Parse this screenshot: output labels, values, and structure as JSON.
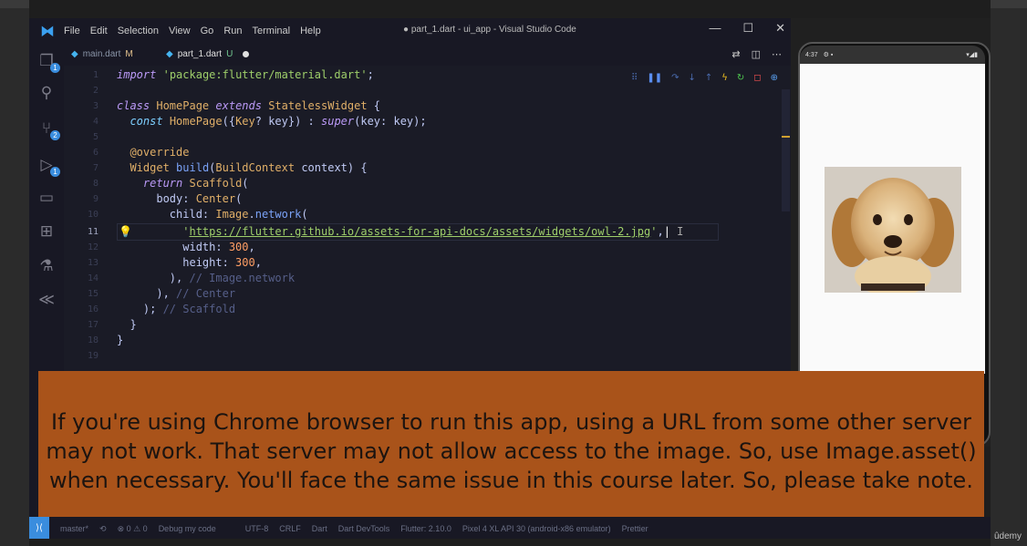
{
  "window": {
    "title": "● part_1.dart - ui_app - Visual Studio Code",
    "menu": [
      "File",
      "Edit",
      "Selection",
      "View",
      "Go",
      "Run",
      "Terminal",
      "Help"
    ],
    "controls": [
      "—",
      "☐",
      "✕"
    ]
  },
  "tabs": [
    {
      "label": "main.dart",
      "status": "M",
      "active": false
    },
    {
      "label": "part_1.dart",
      "status": "U",
      "active": true,
      "unsaved": true
    }
  ],
  "activity": [
    {
      "icon": "files-icon",
      "badge": "1"
    },
    {
      "icon": "search-icon",
      "badge": ""
    },
    {
      "icon": "source-control-icon",
      "badge": "2"
    },
    {
      "icon": "run-debug-icon",
      "badge": "1"
    },
    {
      "icon": "remote-explorer-icon",
      "badge": ""
    },
    {
      "icon": "extensions-icon",
      "badge": ""
    },
    {
      "icon": "testing-icon",
      "badge": ""
    },
    {
      "icon": "flutter-icon",
      "badge": ""
    }
  ],
  "editor": {
    "line_numbers": [
      "1",
      "2",
      "3",
      "4",
      "5",
      "6",
      "7",
      "8",
      "9",
      "10",
      "11",
      "12",
      "13",
      "14",
      "15",
      "16",
      "17",
      "18",
      "19"
    ],
    "url": "https://flutter.github.io/assets-for-api-docs/assets/widgets/owl-2.jpg",
    "width_value": "300",
    "height_value": "300"
  },
  "overlay": {
    "text": "If you're using Chrome browser to run this app, using a URL from some other server may not work. That server may not allow access to the image. So, use Image.asset() when necessary. You'll face the same issue in this course later. So, please take note."
  },
  "statusbar": {
    "items": [
      "master*",
      "⟲",
      "⊗ 0 ⚠ 0",
      "Debug my code",
      "UTF-8",
      "CRLF",
      "Dart",
      "Dart DevTools",
      "Flutter: 2.10.0",
      "Pixel 4 XL API 30 (android-x86 emulator)",
      "Prettier"
    ]
  },
  "phone": {
    "status_time": "4:37"
  },
  "watermark": "ûdemy"
}
